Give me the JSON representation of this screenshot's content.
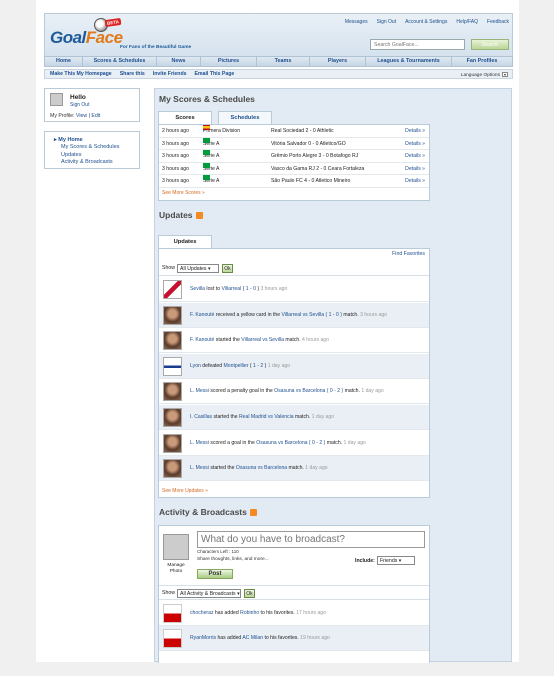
{
  "header": {
    "logo_main": "Goal",
    "logo_accent": "Face",
    "beta": "BETA",
    "tagline": "For Fans of the Beautiful Game",
    "top_links": [
      "Messages",
      "Sign Out",
      "Account & Settings",
      "Help/FAQ",
      "Feedback"
    ],
    "search_placeholder": "Search GoalFace...",
    "search_button": "Search"
  },
  "nav": [
    "Home",
    "Scores & Schedules",
    "News",
    "Pictures",
    "Teams",
    "Players",
    "Leagues & Tournaments",
    "Fan Profiles"
  ],
  "subnav": [
    "Make This My Homepage",
    "Share this",
    "Invite Friends",
    "Email This Page"
  ],
  "language_options": "Language Options",
  "sidebar": {
    "hello": "Hello",
    "sign_out": "Sign Out",
    "profile_label": "My Profile:",
    "view": "View",
    "edit": "Edit",
    "menu": [
      "My Home",
      "My Scores & Schedules",
      "Updates",
      "Activity & Broadcasts"
    ]
  },
  "scores": {
    "title": "My Scores & Schedules",
    "tabs": [
      "Scores",
      "Schedules"
    ],
    "rows": [
      {
        "time": "2 hours ago",
        "league": "Primera Division",
        "flag": "es",
        "match": "Real Sociedad 2 - 0 Athletic",
        "details": "Details »"
      },
      {
        "time": "3 hours ago",
        "league": "Serie A",
        "flag": "br",
        "match": "Vitória Salvador 0 - 0 Atletico/GO",
        "details": "Details »"
      },
      {
        "time": "3 hours ago",
        "league": "Serie A",
        "flag": "br",
        "match": "Grêmio Porto Alegre 3 - 0 Botafogo RJ",
        "details": "Details »"
      },
      {
        "time": "3 hours ago",
        "league": "Serie A",
        "flag": "br",
        "match": "Vasco da Gama RJ 2 - 0 Ceara Fortaleza",
        "details": "Details »"
      },
      {
        "time": "3 hours ago",
        "league": "Serie A",
        "flag": "br",
        "match": "São Paulo FC 4 - 0 Atletico Mineiro",
        "details": "Details »"
      }
    ],
    "see_more": "See More Scores »"
  },
  "updates": {
    "title": "Updates",
    "tab": "Updates",
    "find_favorites": "Find Favorites",
    "show_label": "Show",
    "filter": "All Updates",
    "ok": "Ok",
    "items": [
      {
        "parts": [
          [
            "l",
            "Sevilla"
          ],
          [
            "t",
            " lost to "
          ],
          [
            "l",
            "Villarreal"
          ],
          [
            "t",
            " ( "
          ],
          [
            "l",
            "1 - 0"
          ],
          [
            "t",
            " ) "
          ]
        ],
        "ago": "3 hours ago",
        "avatar": "crest-sevilla"
      },
      {
        "parts": [
          [
            "l",
            "F. Kanouté"
          ],
          [
            "t",
            " received a yellow card in the "
          ],
          [
            "l",
            "Villarreal vs Sevilla ( 1 - 0 )"
          ],
          [
            "t",
            " match. "
          ]
        ],
        "ago": "3 hours ago",
        "avatar": "player"
      },
      {
        "parts": [
          [
            "l",
            "F. Kanouté"
          ],
          [
            "t",
            " started the "
          ],
          [
            "l",
            "Villarreal vs Sevilla"
          ],
          [
            "t",
            " match. "
          ]
        ],
        "ago": "4 hours ago",
        "avatar": "player"
      },
      {
        "parts": [
          [
            "l",
            "Lyon"
          ],
          [
            "t",
            " defeated "
          ],
          [
            "l",
            "Montpellier"
          ],
          [
            "t",
            " ( "
          ],
          [
            "l",
            "1 - 2"
          ],
          [
            "t",
            " ) "
          ]
        ],
        "ago": "1 day ago",
        "avatar": "crest-lyon"
      },
      {
        "parts": [
          [
            "l",
            "L. Messi"
          ],
          [
            "t",
            " scored a penalty goal in the "
          ],
          [
            "l",
            "Osasuna vs Barcelona ( 0 - 2 )"
          ],
          [
            "t",
            " match. "
          ]
        ],
        "ago": "1 day ago",
        "avatar": "player"
      },
      {
        "parts": [
          [
            "l",
            "I. Casillas"
          ],
          [
            "t",
            " started the "
          ],
          [
            "l",
            "Real Madrid vs Valencia"
          ],
          [
            "t",
            " match. "
          ]
        ],
        "ago": "1 day ago",
        "avatar": "player"
      },
      {
        "parts": [
          [
            "l",
            "L. Messi"
          ],
          [
            "t",
            " scored a goal in the "
          ],
          [
            "l",
            "Osasuna vs Barcelona ( 0 - 2 )"
          ],
          [
            "t",
            " match. "
          ]
        ],
        "ago": "1 day ago",
        "avatar": "player"
      },
      {
        "parts": [
          [
            "l",
            "L. Messi"
          ],
          [
            "t",
            " started the "
          ],
          [
            "l",
            "Osasuna vs Barcelona"
          ],
          [
            "t",
            " match. "
          ]
        ],
        "ago": "1 day ago",
        "avatar": "player"
      }
    ],
    "see_more": "See More Updates »"
  },
  "activity": {
    "title": "Activity & Broadcasts",
    "manage_photo": "Manage Photo",
    "broadcast_placeholder": "What do you have to broadcast?",
    "characters_left_label": "Characters Left :",
    "characters_left": "110",
    "share_hint": "Share thoughts, links, and more...",
    "include_label": "Include:",
    "include_value": "Friends",
    "post": "Post",
    "show_label": "Show",
    "filter": "All Activity & Broadcasts",
    "ok": "Ok",
    "items": [
      {
        "user": "chocheraz",
        "text1": " has added ",
        "target": "Robinho",
        "text2": " to his favorites. ",
        "ago": "17 hours ago"
      },
      {
        "user": "RyanMorris",
        "text1": " has added ",
        "target": "AC Milan",
        "text2": " to his favorites. ",
        "ago": "19 hours ago"
      }
    ]
  },
  "colors": {
    "link": "#1e4f8f",
    "accent": "#e07a1a",
    "more": "#d2691e",
    "panel_bg": "#e2ebf3"
  }
}
